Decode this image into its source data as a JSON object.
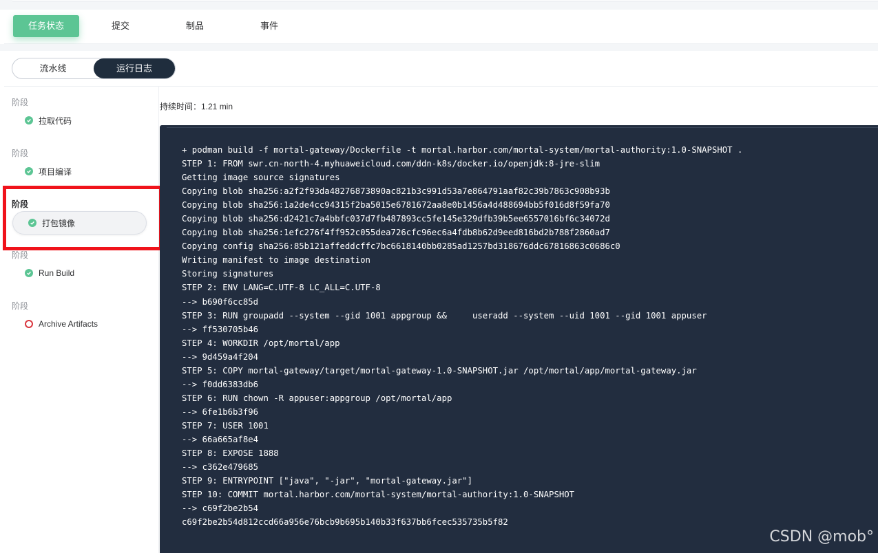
{
  "tabs": [
    {
      "label": "任务状态",
      "active": true
    },
    {
      "label": "提交",
      "active": false
    },
    {
      "label": "制品",
      "active": false
    },
    {
      "label": "事件",
      "active": false
    }
  ],
  "view_toggle": {
    "pipeline_label": "流水线",
    "logs_label": "运行日志",
    "selected": "运行日志"
  },
  "stages": [
    {
      "label": "阶段",
      "step": "拉取代码",
      "status": "success"
    },
    {
      "label": "阶段",
      "step": "项目编译",
      "status": "success"
    },
    {
      "label": "阶段",
      "step": "打包镜像",
      "status": "success",
      "selected": true
    },
    {
      "label": "阶段",
      "step": "Run Build",
      "status": "success"
    },
    {
      "label": "阶段",
      "step": "Archive Artifacts",
      "status": "pending"
    }
  ],
  "duration_text": "持续时间：1.21 min",
  "log_lines": [
    "+ podman build -f mortal-gateway/Dockerfile -t mortal.harbor.com/mortal-system/mortal-authority:1.0-SNAPSHOT .",
    "STEP 1: FROM swr.cn-north-4.myhuaweicloud.com/ddn-k8s/docker.io/openjdk:8-jre-slim",
    "Getting image source signatures",
    "Copying blob sha256:a2f2f93da48276873890ac821b3c991d53a7e864791aaf82c39b7863c908b93b",
    "Copying blob sha256:1a2de4cc94315f2ba5015e6781672aa8e0b1456a4d488694bb5f016d8f59fa70",
    "Copying blob sha256:d2421c7a4bbfc037d7fb487893cc5fe145e329dfb39b5ee6557016bf6c34072d",
    "Copying blob sha256:1efc276f4ff952c055dea726cfc96ec6a4fdb8b62d9eed816bd2b788f2860ad7",
    "Copying config sha256:85b121affeddcffc7bc6618140bb0285ad1257bd318676ddc67816863c0686c0",
    "Writing manifest to image destination",
    "Storing signatures",
    "STEP 2: ENV LANG=C.UTF-8 LC_ALL=C.UTF-8",
    "--> b690f6cc85d",
    "STEP 3: RUN groupadd --system --gid 1001 appgroup &&     useradd --system --uid 1001 --gid 1001 appuser",
    "--> ff530705b46",
    "STEP 4: WORKDIR /opt/mortal/app",
    "--> 9d459a4f204",
    "STEP 5: COPY mortal-gateway/target/mortal-gateway-1.0-SNAPSHOT.jar /opt/mortal/app/mortal-gateway.jar",
    "--> f0dd6383db6",
    "STEP 6: RUN chown -R appuser:appgroup /opt/mortal/app",
    "--> 6fe1b6b3f96",
    "STEP 7: USER 1001",
    "--> 66a665af8e4",
    "STEP 8: EXPOSE 1888",
    "--> c362e479685",
    "STEP 9: ENTRYPOINT [\"java\", \"-jar\", \"mortal-gateway.jar\"]",
    "STEP 10: COMMIT mortal.harbor.com/mortal-system/mortal-authority:1.0-SNAPSHOT",
    "--> c69f2be2b54",
    "c69f2be2b54d812ccd66a956e76bcb9b695b140b33f637bb6fcec535735b5f82"
  ],
  "watermark": "CSDN @mob°",
  "colors": {
    "accent_green": "#5cc594",
    "log_background": "#222d3f",
    "highlight_red": "#f0131b",
    "toggle_active": "#1f2d3d"
  }
}
